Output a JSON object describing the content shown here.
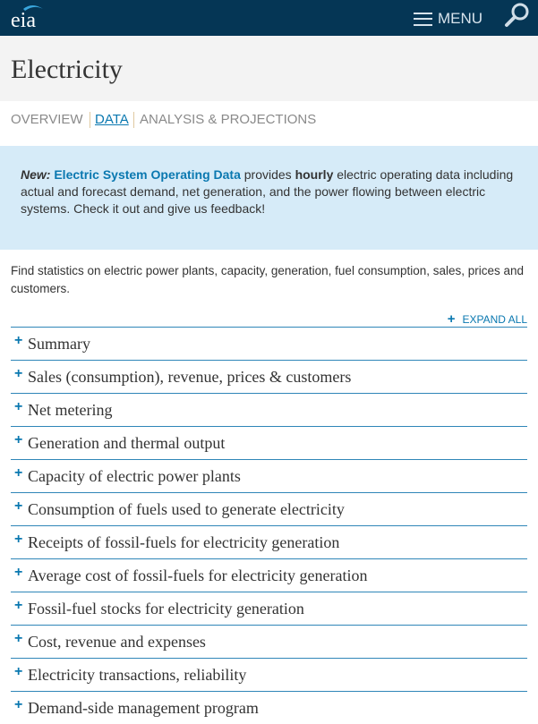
{
  "header": {
    "logo_text": "eia",
    "menu_label": "MENU"
  },
  "page": {
    "title": "Electricity"
  },
  "tabs": [
    {
      "label": "OVERVIEW"
    },
    {
      "label": "DATA"
    },
    {
      "label": "ANALYSIS & PROJECTIONS"
    }
  ],
  "notice": {
    "new_label": "New:",
    "link_text": "Electric System Operating Data",
    "text_before_bold": " provides ",
    "bold_word": "hourly",
    "text_after_bold": " electric operating data including actual and forecast demand, net generation, and the power flowing between electric systems. Check it out and give us feedback!"
  },
  "intro": "Find statistics on electric power plants, capacity, generation, fuel consumption, sales, prices and customers.",
  "expand_all_label": "EXPAND ALL",
  "items": [
    "Summary",
    "Sales (consumption), revenue, prices & customers",
    "Net metering",
    "Generation and thermal output",
    "Capacity of electric power plants",
    "Consumption of fuels used to generate electricity",
    "Receipts of fossil-fuels for electricity generation",
    "Average cost of fossil-fuels for electricity generation",
    "Fossil-fuel stocks for electricity generation",
    "Cost, revenue and expenses",
    "Electricity transactions, reliability",
    "Demand-side management program"
  ],
  "colors": {
    "header_bg": "#053655",
    "accent": "#0a78b0",
    "notice_bg": "#d6ebf8",
    "title_band_bg": "#f3f3f3"
  }
}
